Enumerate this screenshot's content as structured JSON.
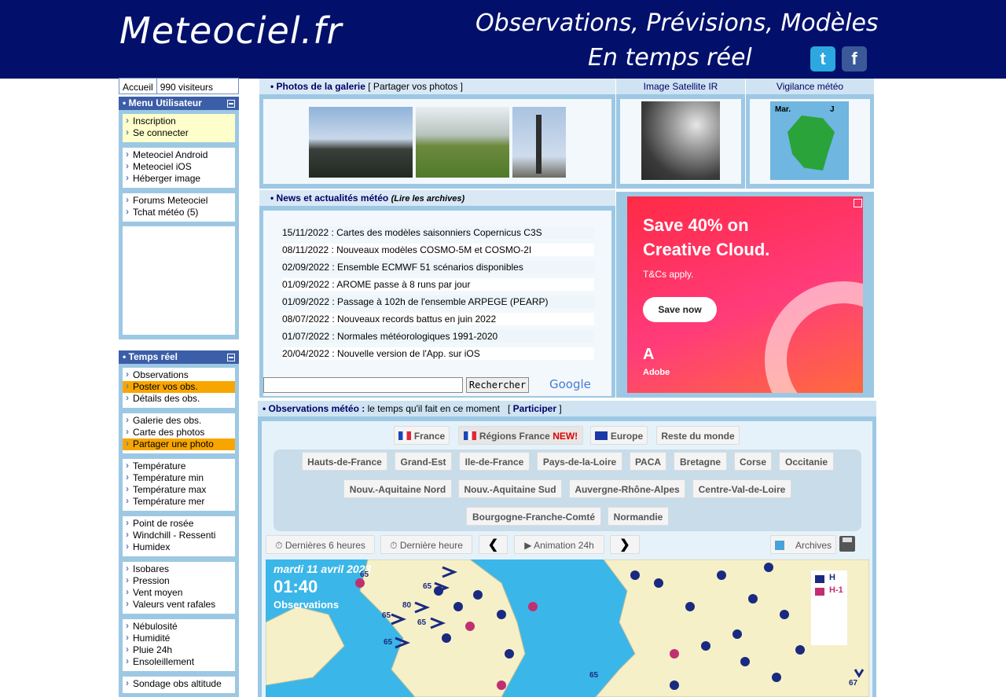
{
  "banner": {
    "logo": "Meteociel.fr",
    "tagline1": "Observations, Prévisions, Modèles",
    "tagline2": "En temps réel",
    "twitter_glyph": "t",
    "facebook_glyph": "f"
  },
  "topbar": {
    "home": "Accueil",
    "visitors": "990 visiteurs"
  },
  "user_menu": {
    "title": "• Menu Utilisateur",
    "group1": [
      "Inscription",
      "Se connecter"
    ],
    "group2": [
      "Meteociel Android",
      "Meteociel iOS",
      "Héberger image"
    ],
    "group3": [
      "Forums Meteociel",
      "Tchat météo (5)"
    ]
  },
  "realtime_menu": {
    "title": "• Temps réel",
    "group1": [
      "Observations",
      "Poster vos obs.",
      "Détails des obs."
    ],
    "group2": [
      "Galerie des obs.",
      "Carte des photos",
      "Partager une photo"
    ],
    "group3": [
      "Température",
      "Température min",
      "Température max",
      "Température mer"
    ],
    "group4": [
      "Point de rosée",
      "Windchill - Ressenti",
      "Humidex"
    ],
    "group5": [
      "Isobares",
      "Pression",
      "Vent moyen",
      "Valeurs vent rafales"
    ],
    "group6": [
      "Nébulosité",
      "Humidité",
      "Pluie 24h",
      "Ensoleillement"
    ],
    "group7": [
      "Sondage obs altitude"
    ]
  },
  "gallery": {
    "bullet": "•",
    "title": "Photos de la galerie",
    "share": "[ Partager vos photos ]"
  },
  "satellite": {
    "title": "Image Satellite IR"
  },
  "vigilance": {
    "title": "Vigilance météo",
    "day1": "Mar.",
    "day2": "J"
  },
  "news": {
    "title": "• News et actualités météo",
    "archives": "(Lire les archives)",
    "items": [
      "15/11/2022 : Cartes des modèles saisonniers Copernicus C3S",
      "08/11/2022 : Nouveaux modèles COSMO-5M et COSMO-2I",
      "02/09/2022 : Ensemble ECMWF 51 scénarios disponibles",
      "01/09/2022 : AROME passe à 8 runs par jour",
      "01/09/2022 : Passage à 102h de l'ensemble ARPEGE (PEARP)",
      "08/07/2022 : Nouveaux records battus en juin 2022",
      "01/07/2022 : Normales météorologiques 1991-2020",
      "20/04/2022 : Nouvelle version de l'App. sur iOS"
    ],
    "search_button": "Rechercher",
    "google": "Google"
  },
  "ad": {
    "line1": "Save 40% on",
    "line2": "Creative Cloud.",
    "terms": "T&Cs apply.",
    "cta": "Save now",
    "brand": "Adobe"
  },
  "obs": {
    "title": "• Observations météo :",
    "subtitle": " le temps qu'il fait en ce moment",
    "participate_open": "[ ",
    "participate": "Participer",
    "participate_close": " ]",
    "tabs": [
      "France",
      "Régions France",
      "Europe",
      "Reste du monde"
    ],
    "new_badge": "NEW!",
    "regions": [
      "Hauts-de-France",
      "Grand-Est",
      "Ile-de-France",
      "Pays-de-la-Loire",
      "PACA",
      "Bretagne",
      "Corse",
      "Occitanie",
      "Nouv.-Aquitaine Nord",
      "Nouv.-Aquitaine Sud",
      "Auvergne-Rhône-Alpes",
      "Centre-Val-de-Loire",
      "Bourgogne-Franche-Comté",
      "Normandie"
    ],
    "last6h": "Dernières 6 heures",
    "last1h": "Dernière heure",
    "anim": "Animation 24h",
    "archives": "Archives",
    "map": {
      "date": "mardi 11 avril 2023",
      "time": "01:40",
      "label": "Observations",
      "legend_h": "H",
      "legend_h1": "H-1",
      "wind_values": [
        "80",
        "65",
        "65",
        "65",
        "65",
        "65",
        "65",
        "67"
      ]
    }
  }
}
